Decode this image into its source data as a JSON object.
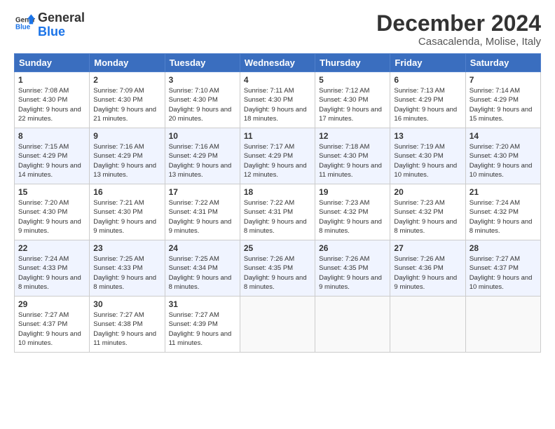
{
  "logo": {
    "line1": "General",
    "line2": "Blue"
  },
  "title": "December 2024",
  "location": "Casacalenda, Molise, Italy",
  "weekdays": [
    "Sunday",
    "Monday",
    "Tuesday",
    "Wednesday",
    "Thursday",
    "Friday",
    "Saturday"
  ],
  "weeks": [
    [
      {
        "day": "1",
        "sunrise": "Sunrise: 7:08 AM",
        "sunset": "Sunset: 4:30 PM",
        "daylight": "Daylight: 9 hours and 22 minutes."
      },
      {
        "day": "2",
        "sunrise": "Sunrise: 7:09 AM",
        "sunset": "Sunset: 4:30 PM",
        "daylight": "Daylight: 9 hours and 21 minutes."
      },
      {
        "day": "3",
        "sunrise": "Sunrise: 7:10 AM",
        "sunset": "Sunset: 4:30 PM",
        "daylight": "Daylight: 9 hours and 20 minutes."
      },
      {
        "day": "4",
        "sunrise": "Sunrise: 7:11 AM",
        "sunset": "Sunset: 4:30 PM",
        "daylight": "Daylight: 9 hours and 18 minutes."
      },
      {
        "day": "5",
        "sunrise": "Sunrise: 7:12 AM",
        "sunset": "Sunset: 4:30 PM",
        "daylight": "Daylight: 9 hours and 17 minutes."
      },
      {
        "day": "6",
        "sunrise": "Sunrise: 7:13 AM",
        "sunset": "Sunset: 4:29 PM",
        "daylight": "Daylight: 9 hours and 16 minutes."
      },
      {
        "day": "7",
        "sunrise": "Sunrise: 7:14 AM",
        "sunset": "Sunset: 4:29 PM",
        "daylight": "Daylight: 9 hours and 15 minutes."
      }
    ],
    [
      {
        "day": "8",
        "sunrise": "Sunrise: 7:15 AM",
        "sunset": "Sunset: 4:29 PM",
        "daylight": "Daylight: 9 hours and 14 minutes."
      },
      {
        "day": "9",
        "sunrise": "Sunrise: 7:16 AM",
        "sunset": "Sunset: 4:29 PM",
        "daylight": "Daylight: 9 hours and 13 minutes."
      },
      {
        "day": "10",
        "sunrise": "Sunrise: 7:16 AM",
        "sunset": "Sunset: 4:29 PM",
        "daylight": "Daylight: 9 hours and 13 minutes."
      },
      {
        "day": "11",
        "sunrise": "Sunrise: 7:17 AM",
        "sunset": "Sunset: 4:29 PM",
        "daylight": "Daylight: 9 hours and 12 minutes."
      },
      {
        "day": "12",
        "sunrise": "Sunrise: 7:18 AM",
        "sunset": "Sunset: 4:30 PM",
        "daylight": "Daylight: 9 hours and 11 minutes."
      },
      {
        "day": "13",
        "sunrise": "Sunrise: 7:19 AM",
        "sunset": "Sunset: 4:30 PM",
        "daylight": "Daylight: 9 hours and 10 minutes."
      },
      {
        "day": "14",
        "sunrise": "Sunrise: 7:20 AM",
        "sunset": "Sunset: 4:30 PM",
        "daylight": "Daylight: 9 hours and 10 minutes."
      }
    ],
    [
      {
        "day": "15",
        "sunrise": "Sunrise: 7:20 AM",
        "sunset": "Sunset: 4:30 PM",
        "daylight": "Daylight: 9 hours and 9 minutes."
      },
      {
        "day": "16",
        "sunrise": "Sunrise: 7:21 AM",
        "sunset": "Sunset: 4:30 PM",
        "daylight": "Daylight: 9 hours and 9 minutes."
      },
      {
        "day": "17",
        "sunrise": "Sunrise: 7:22 AM",
        "sunset": "Sunset: 4:31 PM",
        "daylight": "Daylight: 9 hours and 9 minutes."
      },
      {
        "day": "18",
        "sunrise": "Sunrise: 7:22 AM",
        "sunset": "Sunset: 4:31 PM",
        "daylight": "Daylight: 9 hours and 8 minutes."
      },
      {
        "day": "19",
        "sunrise": "Sunrise: 7:23 AM",
        "sunset": "Sunset: 4:32 PM",
        "daylight": "Daylight: 9 hours and 8 minutes."
      },
      {
        "day": "20",
        "sunrise": "Sunrise: 7:23 AM",
        "sunset": "Sunset: 4:32 PM",
        "daylight": "Daylight: 9 hours and 8 minutes."
      },
      {
        "day": "21",
        "sunrise": "Sunrise: 7:24 AM",
        "sunset": "Sunset: 4:32 PM",
        "daylight": "Daylight: 9 hours and 8 minutes."
      }
    ],
    [
      {
        "day": "22",
        "sunrise": "Sunrise: 7:24 AM",
        "sunset": "Sunset: 4:33 PM",
        "daylight": "Daylight: 9 hours and 8 minutes."
      },
      {
        "day": "23",
        "sunrise": "Sunrise: 7:25 AM",
        "sunset": "Sunset: 4:33 PM",
        "daylight": "Daylight: 9 hours and 8 minutes."
      },
      {
        "day": "24",
        "sunrise": "Sunrise: 7:25 AM",
        "sunset": "Sunset: 4:34 PM",
        "daylight": "Daylight: 9 hours and 8 minutes."
      },
      {
        "day": "25",
        "sunrise": "Sunrise: 7:26 AM",
        "sunset": "Sunset: 4:35 PM",
        "daylight": "Daylight: 9 hours and 8 minutes."
      },
      {
        "day": "26",
        "sunrise": "Sunrise: 7:26 AM",
        "sunset": "Sunset: 4:35 PM",
        "daylight": "Daylight: 9 hours and 9 minutes."
      },
      {
        "day": "27",
        "sunrise": "Sunrise: 7:26 AM",
        "sunset": "Sunset: 4:36 PM",
        "daylight": "Daylight: 9 hours and 9 minutes."
      },
      {
        "day": "28",
        "sunrise": "Sunrise: 7:27 AM",
        "sunset": "Sunset: 4:37 PM",
        "daylight": "Daylight: 9 hours and 10 minutes."
      }
    ],
    [
      {
        "day": "29",
        "sunrise": "Sunrise: 7:27 AM",
        "sunset": "Sunset: 4:37 PM",
        "daylight": "Daylight: 9 hours and 10 minutes."
      },
      {
        "day": "30",
        "sunrise": "Sunrise: 7:27 AM",
        "sunset": "Sunset: 4:38 PM",
        "daylight": "Daylight: 9 hours and 11 minutes."
      },
      {
        "day": "31",
        "sunrise": "Sunrise: 7:27 AM",
        "sunset": "Sunset: 4:39 PM",
        "daylight": "Daylight: 9 hours and 11 minutes."
      },
      null,
      null,
      null,
      null
    ]
  ]
}
